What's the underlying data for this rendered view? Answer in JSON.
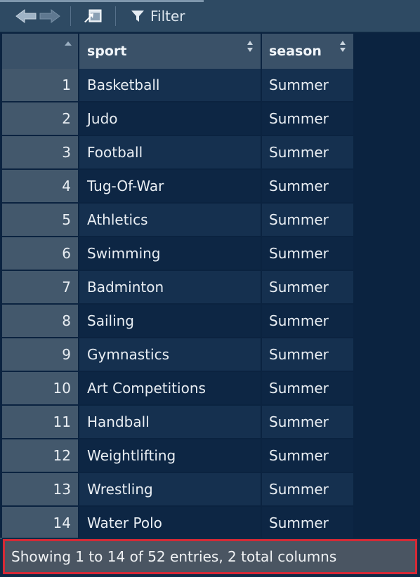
{
  "toolbar": {
    "filter_label": "Filter",
    "icons": [
      "back-arrow-icon",
      "forward-arrow-icon",
      "popout-window-icon",
      "filter-funnel-icon"
    ]
  },
  "table": {
    "columns": [
      "",
      "sport",
      "season"
    ],
    "rows": [
      {
        "index": "1",
        "sport": "Basketball",
        "season": "Summer"
      },
      {
        "index": "2",
        "sport": "Judo",
        "season": "Summer"
      },
      {
        "index": "3",
        "sport": "Football",
        "season": "Summer"
      },
      {
        "index": "4",
        "sport": "Tug-Of-War",
        "season": "Summer"
      },
      {
        "index": "5",
        "sport": "Athletics",
        "season": "Summer"
      },
      {
        "index": "6",
        "sport": "Swimming",
        "season": "Summer"
      },
      {
        "index": "7",
        "sport": "Badminton",
        "season": "Summer"
      },
      {
        "index": "8",
        "sport": "Sailing",
        "season": "Summer"
      },
      {
        "index": "9",
        "sport": "Gymnastics",
        "season": "Summer"
      },
      {
        "index": "10",
        "sport": "Art Competitions",
        "season": "Summer"
      },
      {
        "index": "11",
        "sport": "Handball",
        "season": "Summer"
      },
      {
        "index": "12",
        "sport": "Weightlifting",
        "season": "Summer"
      },
      {
        "index": "13",
        "sport": "Wrestling",
        "season": "Summer"
      },
      {
        "index": "14",
        "sport": "Water Polo",
        "season": "Summer"
      }
    ]
  },
  "footer": {
    "status": "Showing 1 to 14 of 52 entries, 2 total columns"
  },
  "colors": {
    "highlight_border": "#d62a36",
    "header_bg": "#3a5168",
    "toolbar_bg": "#2e4a63"
  }
}
